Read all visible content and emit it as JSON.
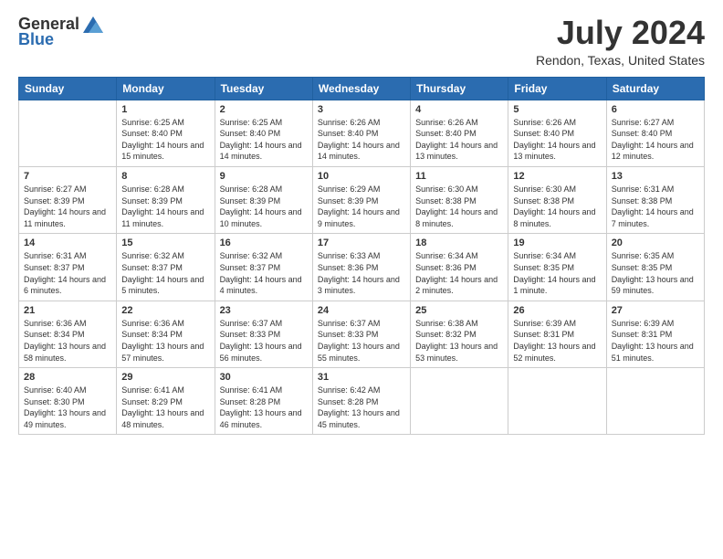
{
  "header": {
    "logo_general": "General",
    "logo_blue": "Blue",
    "month_title": "July 2024",
    "location": "Rendon, Texas, United States"
  },
  "days_of_week": [
    "Sunday",
    "Monday",
    "Tuesday",
    "Wednesday",
    "Thursday",
    "Friday",
    "Saturday"
  ],
  "weeks": [
    [
      {
        "day": "",
        "info": ""
      },
      {
        "day": "1",
        "info": "Sunrise: 6:25 AM\nSunset: 8:40 PM\nDaylight: 14 hours and 15 minutes."
      },
      {
        "day": "2",
        "info": "Sunrise: 6:25 AM\nSunset: 8:40 PM\nDaylight: 14 hours and 14 minutes."
      },
      {
        "day": "3",
        "info": "Sunrise: 6:26 AM\nSunset: 8:40 PM\nDaylight: 14 hours and 14 minutes."
      },
      {
        "day": "4",
        "info": "Sunrise: 6:26 AM\nSunset: 8:40 PM\nDaylight: 14 hours and 13 minutes."
      },
      {
        "day": "5",
        "info": "Sunrise: 6:26 AM\nSunset: 8:40 PM\nDaylight: 14 hours and 13 minutes."
      },
      {
        "day": "6",
        "info": "Sunrise: 6:27 AM\nSunset: 8:40 PM\nDaylight: 14 hours and 12 minutes."
      }
    ],
    [
      {
        "day": "7",
        "info": "Sunrise: 6:27 AM\nSunset: 8:39 PM\nDaylight: 14 hours and 11 minutes."
      },
      {
        "day": "8",
        "info": "Sunrise: 6:28 AM\nSunset: 8:39 PM\nDaylight: 14 hours and 11 minutes."
      },
      {
        "day": "9",
        "info": "Sunrise: 6:28 AM\nSunset: 8:39 PM\nDaylight: 14 hours and 10 minutes."
      },
      {
        "day": "10",
        "info": "Sunrise: 6:29 AM\nSunset: 8:39 PM\nDaylight: 14 hours and 9 minutes."
      },
      {
        "day": "11",
        "info": "Sunrise: 6:30 AM\nSunset: 8:38 PM\nDaylight: 14 hours and 8 minutes."
      },
      {
        "day": "12",
        "info": "Sunrise: 6:30 AM\nSunset: 8:38 PM\nDaylight: 14 hours and 8 minutes."
      },
      {
        "day": "13",
        "info": "Sunrise: 6:31 AM\nSunset: 8:38 PM\nDaylight: 14 hours and 7 minutes."
      }
    ],
    [
      {
        "day": "14",
        "info": "Sunrise: 6:31 AM\nSunset: 8:37 PM\nDaylight: 14 hours and 6 minutes."
      },
      {
        "day": "15",
        "info": "Sunrise: 6:32 AM\nSunset: 8:37 PM\nDaylight: 14 hours and 5 minutes."
      },
      {
        "day": "16",
        "info": "Sunrise: 6:32 AM\nSunset: 8:37 PM\nDaylight: 14 hours and 4 minutes."
      },
      {
        "day": "17",
        "info": "Sunrise: 6:33 AM\nSunset: 8:36 PM\nDaylight: 14 hours and 3 minutes."
      },
      {
        "day": "18",
        "info": "Sunrise: 6:34 AM\nSunset: 8:36 PM\nDaylight: 14 hours and 2 minutes."
      },
      {
        "day": "19",
        "info": "Sunrise: 6:34 AM\nSunset: 8:35 PM\nDaylight: 14 hours and 1 minute."
      },
      {
        "day": "20",
        "info": "Sunrise: 6:35 AM\nSunset: 8:35 PM\nDaylight: 13 hours and 59 minutes."
      }
    ],
    [
      {
        "day": "21",
        "info": "Sunrise: 6:36 AM\nSunset: 8:34 PM\nDaylight: 13 hours and 58 minutes."
      },
      {
        "day": "22",
        "info": "Sunrise: 6:36 AM\nSunset: 8:34 PM\nDaylight: 13 hours and 57 minutes."
      },
      {
        "day": "23",
        "info": "Sunrise: 6:37 AM\nSunset: 8:33 PM\nDaylight: 13 hours and 56 minutes."
      },
      {
        "day": "24",
        "info": "Sunrise: 6:37 AM\nSunset: 8:33 PM\nDaylight: 13 hours and 55 minutes."
      },
      {
        "day": "25",
        "info": "Sunrise: 6:38 AM\nSunset: 8:32 PM\nDaylight: 13 hours and 53 minutes."
      },
      {
        "day": "26",
        "info": "Sunrise: 6:39 AM\nSunset: 8:31 PM\nDaylight: 13 hours and 52 minutes."
      },
      {
        "day": "27",
        "info": "Sunrise: 6:39 AM\nSunset: 8:31 PM\nDaylight: 13 hours and 51 minutes."
      }
    ],
    [
      {
        "day": "28",
        "info": "Sunrise: 6:40 AM\nSunset: 8:30 PM\nDaylight: 13 hours and 49 minutes."
      },
      {
        "day": "29",
        "info": "Sunrise: 6:41 AM\nSunset: 8:29 PM\nDaylight: 13 hours and 48 minutes."
      },
      {
        "day": "30",
        "info": "Sunrise: 6:41 AM\nSunset: 8:28 PM\nDaylight: 13 hours and 46 minutes."
      },
      {
        "day": "31",
        "info": "Sunrise: 6:42 AM\nSunset: 8:28 PM\nDaylight: 13 hours and 45 minutes."
      },
      {
        "day": "",
        "info": ""
      },
      {
        "day": "",
        "info": ""
      },
      {
        "day": "",
        "info": ""
      }
    ]
  ]
}
